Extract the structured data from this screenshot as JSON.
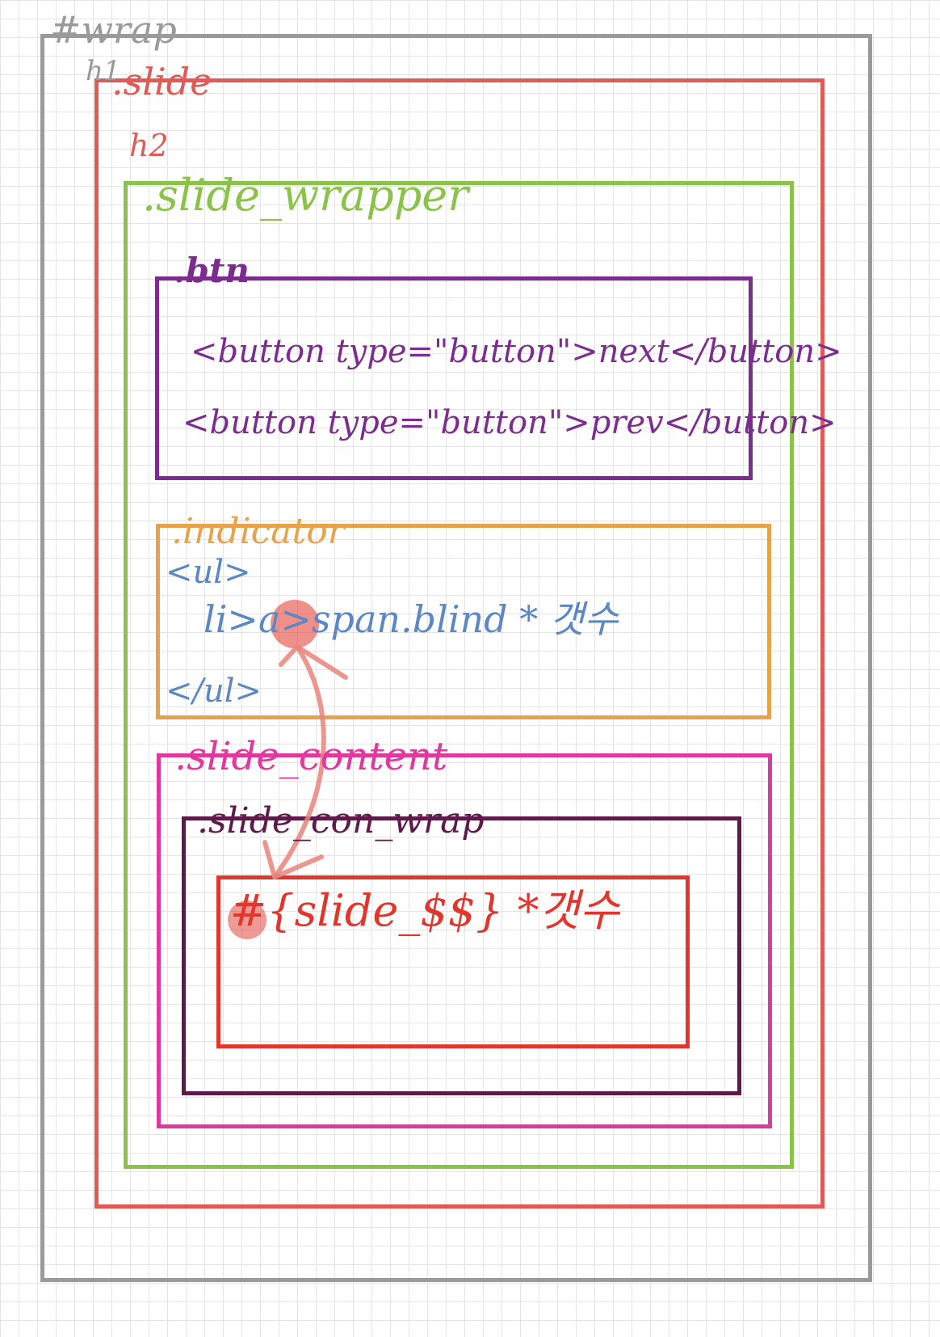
{
  "diagram": {
    "wrap": {
      "label": "#wrap",
      "heading": "h1",
      "color": "#9a9a9a"
    },
    "slide": {
      "label": ".slide",
      "heading": "h2",
      "color": "#e05a56"
    },
    "slide_wrapper": {
      "label": ".slide_wrapper",
      "color": "#8bc34a"
    },
    "btn": {
      "label": ".btn",
      "lines": [
        "<button type=\"button\">next</button>",
        "<button type=\"button\">prev</button>"
      ],
      "color": "#7b2d8e"
    },
    "indicator": {
      "label": ".indicator",
      "ul_open": "<ul>",
      "li_line": "li>a>span.blind * 갯수",
      "ul_close": "</ul>",
      "color": "#e8a24a",
      "code_color": "#5b87c2"
    },
    "slide_content": {
      "label": ".slide_content",
      "color": "#e0389f"
    },
    "slide_con_wrap": {
      "label": ".slide_con_wrap",
      "color": "#5e1a4a"
    },
    "slide_item": {
      "label": "#{slide_$$} *갯수",
      "color": "#e2352b"
    }
  }
}
